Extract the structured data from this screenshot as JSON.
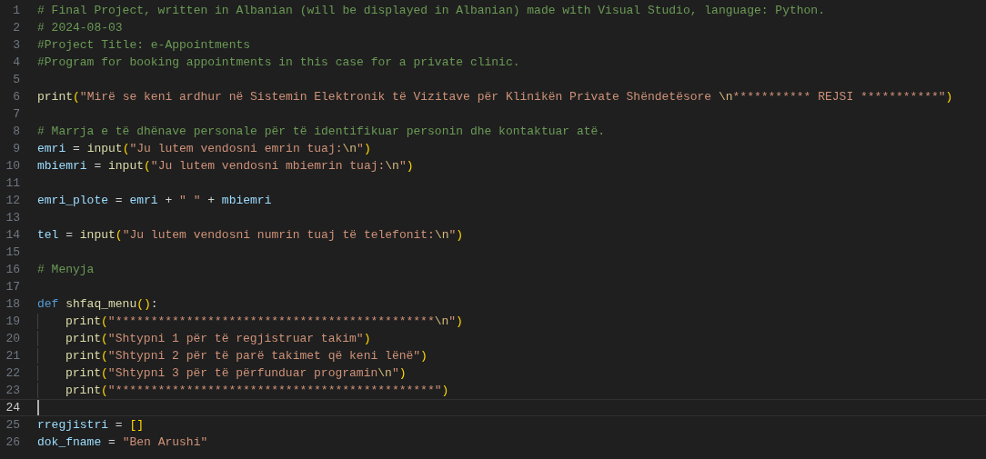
{
  "lines": [
    {
      "number": "1",
      "current": false,
      "tokens": [
        {
          "kind": "comment",
          "text": "# Final Project, written in Albanian (will be displayed in Albanian) made with Visual Studio, language: Python."
        }
      ]
    },
    {
      "number": "2",
      "current": false,
      "tokens": [
        {
          "kind": "comment",
          "text": "# 2024-08-03"
        }
      ]
    },
    {
      "number": "3",
      "current": false,
      "tokens": [
        {
          "kind": "comment",
          "text": "#Project Title: e-Appointments"
        }
      ]
    },
    {
      "number": "4",
      "current": false,
      "tokens": [
        {
          "kind": "comment",
          "text": "#Program for booking appointments in this case for a private clinic."
        }
      ]
    },
    {
      "number": "5",
      "current": false
    },
    {
      "number": "6",
      "current": false,
      "tokens": [
        {
          "kind": "function",
          "text": "print"
        },
        {
          "kind": "bracket",
          "text": "("
        },
        {
          "kind": "string",
          "text": "\"Mirë se keni ardhur në Sistemin Elektronik të Vizitave për Klinikën Private Shëndetësore "
        },
        {
          "kind": "escape",
          "text": "\\n"
        },
        {
          "kind": "string",
          "text": "*********** REJSI ***********\""
        },
        {
          "kind": "bracket",
          "text": ")"
        }
      ]
    },
    {
      "number": "7",
      "current": false
    },
    {
      "number": "8",
      "current": false,
      "tokens": [
        {
          "kind": "comment",
          "text": "# Marrja e të dhënave personale për të identifikuar personin dhe kontaktuar atë."
        }
      ]
    },
    {
      "number": "9",
      "current": false,
      "tokens": [
        {
          "kind": "variable",
          "text": "emri"
        },
        {
          "kind": "plain",
          "text": " = "
        },
        {
          "kind": "function",
          "text": "input"
        },
        {
          "kind": "bracket",
          "text": "("
        },
        {
          "kind": "string",
          "text": "\"Ju lutem vendosni emrin tuaj:"
        },
        {
          "kind": "escape",
          "text": "\\n"
        },
        {
          "kind": "string",
          "text": "\""
        },
        {
          "kind": "bracket",
          "text": ")"
        }
      ]
    },
    {
      "number": "10",
      "current": false,
      "tokens": [
        {
          "kind": "variable",
          "text": "mbiemri"
        },
        {
          "kind": "plain",
          "text": " = "
        },
        {
          "kind": "function",
          "text": "input"
        },
        {
          "kind": "bracket",
          "text": "("
        },
        {
          "kind": "string",
          "text": "\"Ju lutem vendosni mbiemrin tuaj:"
        },
        {
          "kind": "escape",
          "text": "\\n"
        },
        {
          "kind": "string",
          "text": "\""
        },
        {
          "kind": "bracket",
          "text": ")"
        }
      ]
    },
    {
      "number": "11",
      "current": false
    },
    {
      "number": "12",
      "current": false,
      "tokens": [
        {
          "kind": "variable",
          "text": "emri_plote"
        },
        {
          "kind": "plain",
          "text": " = "
        },
        {
          "kind": "variable",
          "text": "emri"
        },
        {
          "kind": "plain",
          "text": " + "
        },
        {
          "kind": "string",
          "text": "\" \""
        },
        {
          "kind": "plain",
          "text": " + "
        },
        {
          "kind": "variable",
          "text": "mbiemri"
        }
      ]
    },
    {
      "number": "13",
      "current": false
    },
    {
      "number": "14",
      "current": false,
      "tokens": [
        {
          "kind": "variable",
          "text": "tel"
        },
        {
          "kind": "plain",
          "text": " = "
        },
        {
          "kind": "function",
          "text": "input"
        },
        {
          "kind": "bracket",
          "text": "("
        },
        {
          "kind": "string",
          "text": "\"Ju lutem vendosni numrin tuaj të telefonit:"
        },
        {
          "kind": "escape",
          "text": "\\n"
        },
        {
          "kind": "string",
          "text": "\""
        },
        {
          "kind": "bracket",
          "text": ")"
        }
      ]
    },
    {
      "number": "15",
      "current": false
    },
    {
      "number": "16",
      "current": false,
      "tokens": [
        {
          "kind": "comment",
          "text": "# Menyja"
        }
      ]
    },
    {
      "number": "17",
      "current": false
    },
    {
      "number": "18",
      "current": false,
      "tokens": [
        {
          "kind": "keyword",
          "text": "def"
        },
        {
          "kind": "function",
          "text": "shfaq_menu"
        },
        {
          "kind": "bracket",
          "text": "()"
        },
        {
          "kind": "plain",
          "text": ":"
        }
      ],
      "children": [
        {
          "number": "19",
          "current": false,
          "tokens": [
            {
              "kind": "function",
              "text": "print"
            },
            {
              "kind": "bracket",
              "text": "("
            },
            {
              "kind": "string",
              "text": "\"*********************************************"
            },
            {
              "kind": "escape",
              "text": "\\n"
            },
            {
              "kind": "string",
              "text": "\""
            },
            {
              "kind": "bracket",
              "text": ")"
            }
          ]
        },
        {
          "number": "20",
          "current": false,
          "tokens": [
            {
              "kind": "function",
              "text": "print"
            },
            {
              "kind": "bracket",
              "text": "("
            },
            {
              "kind": "string",
              "text": "\"Shtypni 1 për të regjistruar takim\""
            },
            {
              "kind": "bracket",
              "text": ")"
            }
          ]
        },
        {
          "number": "21",
          "current": false,
          "tokens": [
            {
              "kind": "function",
              "text": "print"
            },
            {
              "kind": "bracket",
              "text": "("
            },
            {
              "kind": "string",
              "text": "\"Shtypni 2 për të parë takimet që keni lënë\""
            },
            {
              "kind": "bracket",
              "text": ")"
            }
          ]
        },
        {
          "number": "22",
          "current": false,
          "tokens": [
            {
              "kind": "function",
              "text": "print"
            },
            {
              "kind": "bracket",
              "text": "("
            },
            {
              "kind": "string",
              "text": "\"Shtypni 3 për të përfunduar programin"
            },
            {
              "kind": "escape",
              "text": "\\n"
            },
            {
              "kind": "string",
              "text": "\""
            },
            {
              "kind": "bracket",
              "text": ")"
            }
          ]
        },
        {
          "number": "23",
          "current": false,
          "tokens": [
            {
              "kind": "function",
              "text": "print"
            },
            {
              "kind": "bracket",
              "text": "("
            },
            {
              "kind": "string",
              "text": "\"*********************************************\""
            },
            {
              "kind": "bracket",
              "text": ")"
            }
          ]
        }
      ]
    },
    {
      "number": "24",
      "current": true
    },
    {
      "number": "25",
      "current": false,
      "tokens": [
        {
          "kind": "variable",
          "text": "rregjistri"
        },
        {
          "kind": "plain",
          "text": " = "
        },
        {
          "kind": "bracket",
          "text": "[]"
        }
      ]
    },
    {
      "number": "26",
      "current": false,
      "tokens": [
        {
          "kind": "variable",
          "text": "dok_fname"
        },
        {
          "kind": "plain",
          "text": " = "
        },
        {
          "kind": "string",
          "text": "\"Ben Arushi\""
        }
      ]
    }
  ]
}
